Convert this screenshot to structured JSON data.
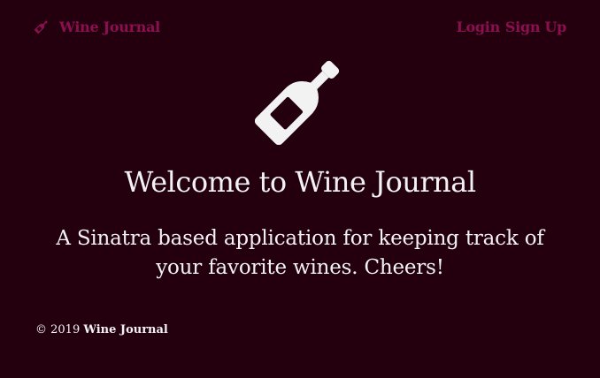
{
  "app": {
    "brand_name": "Wine Journal",
    "brand_icon": "wine-bottle-icon"
  },
  "nav": {
    "login_label": "Login",
    "signup_label": "Sign Up"
  },
  "hero": {
    "icon": "wine-bottle-icon",
    "title": "Welcome to Wine Journal",
    "tagline": "A Sinatra based application for keeping track of your favorite wines. Cheers!"
  },
  "footer": {
    "copyright": "© 2019",
    "brand_name": "Wine Journal"
  },
  "colors": {
    "background": "#24000f",
    "accent": "#8c0f4f",
    "text": "#f2f2f2"
  }
}
